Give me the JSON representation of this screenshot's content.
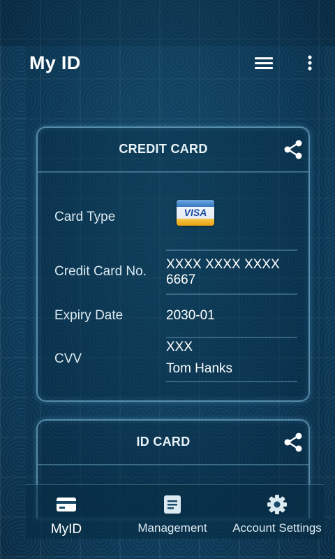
{
  "app_bar": {
    "title": "My ID",
    "icons": [
      "menu-icon",
      "more-vert-icon"
    ]
  },
  "credit_card": {
    "title": "CREDIT CARD",
    "share_icon": "share-icon",
    "fields": {
      "card_type_label": "Card Type",
      "card_type_logo_text": "VISA",
      "card_number_label": "Credit Card No.",
      "card_number_value": "XXXX XXXX XXXX 6667",
      "expiry_label": "Expiry Date",
      "expiry_value": "2030-01",
      "cvv_label": "CVV",
      "cvv_value": "XXX",
      "holder_value": "Tom Hanks"
    }
  },
  "id_card": {
    "title": "ID CARD",
    "share_icon": "share-icon"
  },
  "bottom_nav": {
    "items": [
      {
        "label": "MyID",
        "icon": "credit-card-icon",
        "active": true
      },
      {
        "label": "Management",
        "icon": "document-icon",
        "active": false
      },
      {
        "label": "Account Settings",
        "icon": "gear-icon",
        "active": false
      }
    ]
  },
  "colors": {
    "background": "#0f4060",
    "card_border": "#96d2f0",
    "text": "#ffffff"
  }
}
